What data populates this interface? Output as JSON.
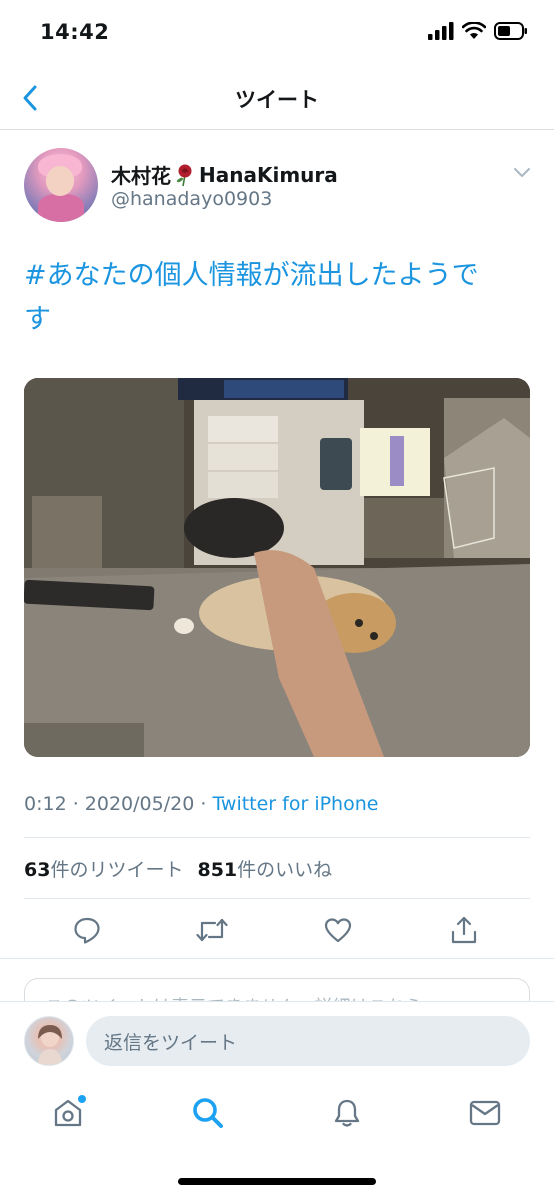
{
  "status_bar": {
    "time": "14:42"
  },
  "nav": {
    "title": "ツイート",
    "back_icon": "chevron-left-icon"
  },
  "tweet": {
    "display_name": "木村花",
    "display_name_suffix": "HanaKimura",
    "handle": "@hanadayo0903",
    "text_line1": "#あなたの個人情報が流出したようで",
    "text_line2": "す",
    "time": "0:12",
    "date": "2020/05/20",
    "separator": " · ",
    "source": "Twitter for iPhone",
    "retweet_count": "63",
    "retweet_label": "件のリツイート",
    "like_count": "851",
    "like_label": "件のいいね"
  },
  "actions": [
    {
      "name": "reply",
      "icon": "reply-icon"
    },
    {
      "name": "retweet",
      "icon": "retweet-icon"
    },
    {
      "name": "like",
      "icon": "heart-icon"
    },
    {
      "name": "share",
      "icon": "share-icon"
    }
  ],
  "notice": {
    "text": "このツイートは表示できません。詳細はこちら"
  },
  "reply": {
    "placeholder": "返信をツイート"
  },
  "tabs": [
    {
      "name": "home",
      "icon": "home-icon",
      "has_notification_dot": true
    },
    {
      "name": "search",
      "icon": "search-icon",
      "active": true
    },
    {
      "name": "notifications",
      "icon": "bell-icon"
    },
    {
      "name": "messages",
      "icon": "mail-icon"
    }
  ],
  "colors": {
    "accent": "#1b95e0",
    "secondary_text": "#657786",
    "divider": "#e1e8ed"
  }
}
